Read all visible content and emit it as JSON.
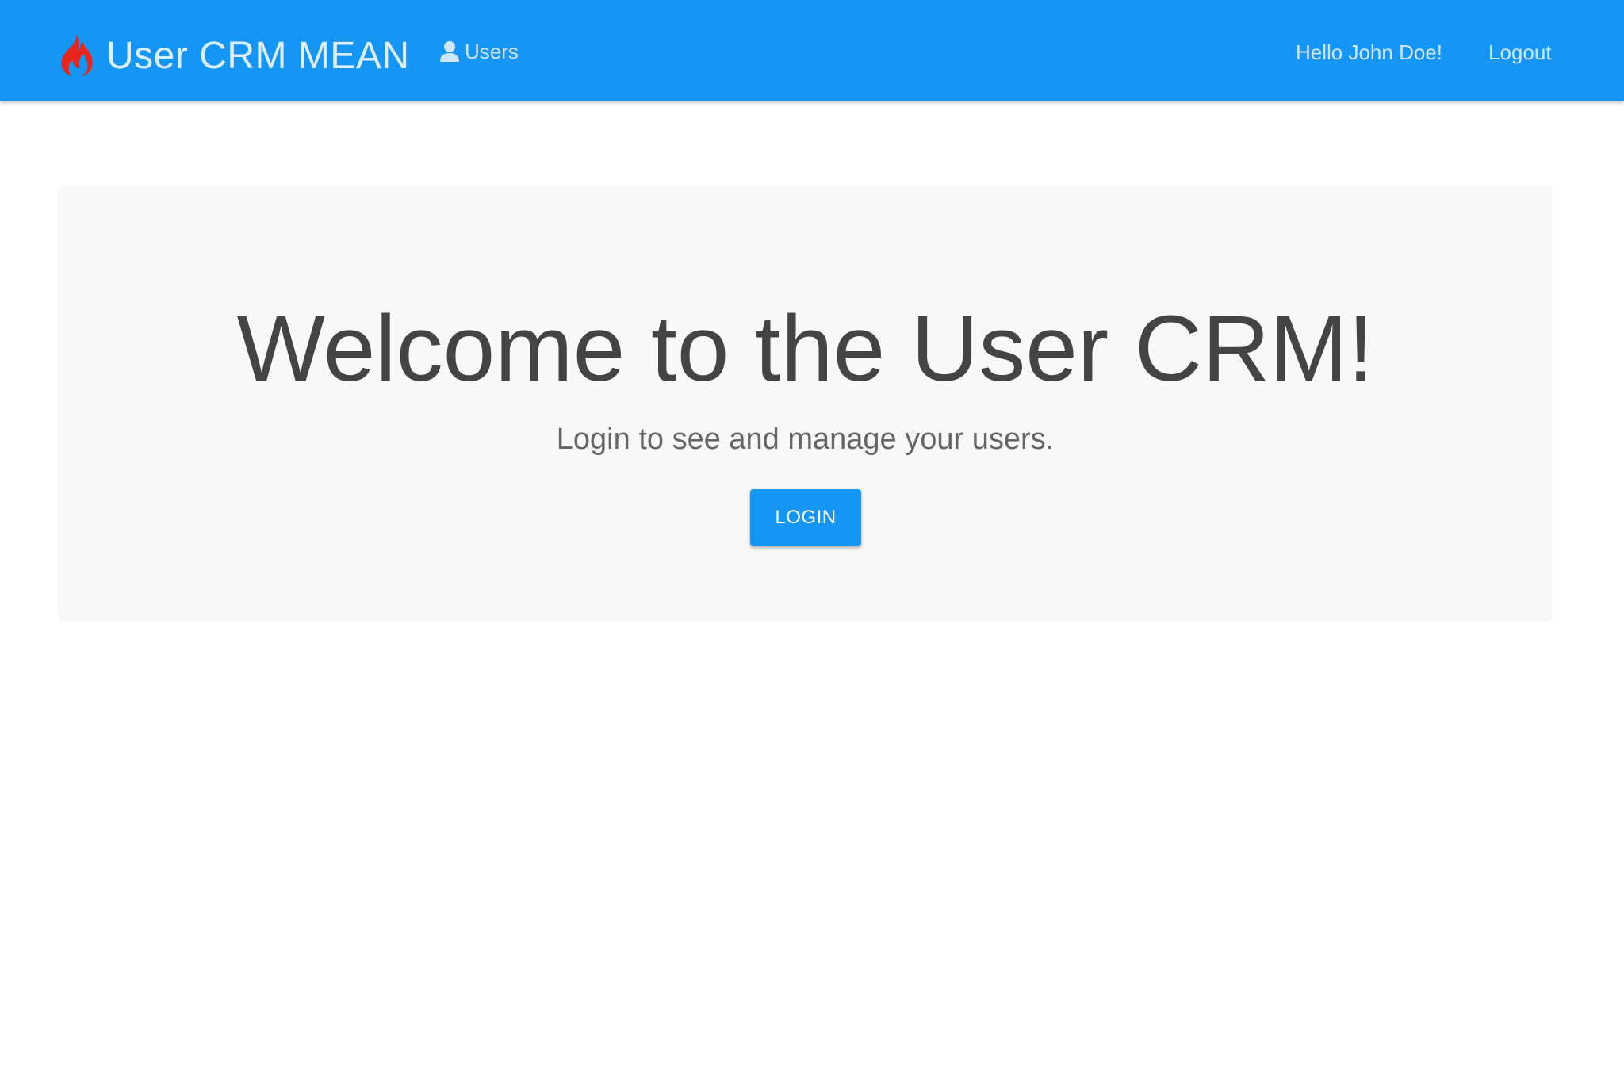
{
  "navbar": {
    "brand_icon": "fire-icon",
    "brand_title": "User CRM MEAN",
    "users_icon": "user-icon",
    "users_label": "Users",
    "greeting": "Hello John Doe!",
    "logout_label": "Logout",
    "background_color": "#1595f4",
    "brand_icon_color": "#e8251c"
  },
  "jumbotron": {
    "title": "Welcome to the User CRM!",
    "subtitle": "Login to see and manage your users.",
    "login_label": "LOGIN",
    "background_color": "#f8f8f8"
  }
}
